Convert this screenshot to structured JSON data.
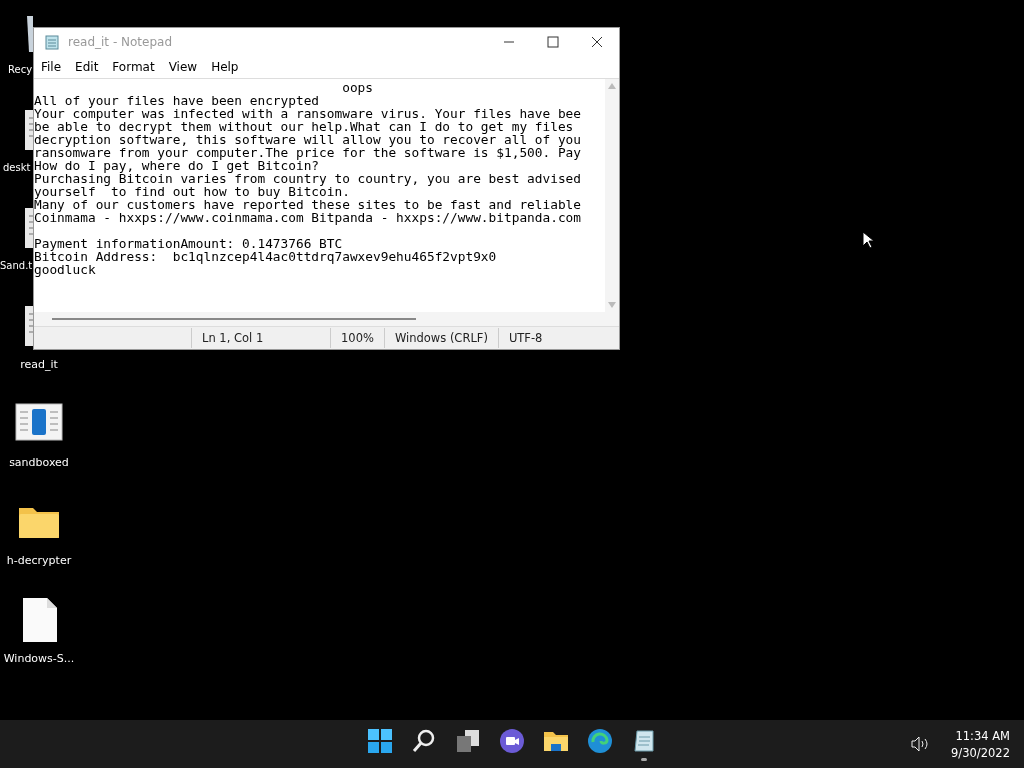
{
  "desktop_icons": [
    {
      "label": "Recy",
      "kind": "recycle"
    },
    {
      "label": "deskt",
      "kind": "doc"
    },
    {
      "label": "Sand.t",
      "kind": "doc"
    },
    {
      "label": "read_it",
      "kind": "text"
    },
    {
      "label": "sandboxed",
      "kind": "app"
    },
    {
      "label": "h-decrypter",
      "kind": "folder"
    },
    {
      "label": "Windows-S...",
      "kind": "file"
    }
  ],
  "window": {
    "title": "read_it - Notepad",
    "menu": [
      "File",
      "Edit",
      "Format",
      "View",
      "Help"
    ],
    "text": "                                        oops\nAll of your files have been encrypted\nYour computer was infected with a ransomware virus. Your files have bee\nbe able to decrypt them without our help.What can I do to get my files\ndecryption software, this software will allow you to recover all of you\nransomware from your computer.The price for the software is $1,500. Pay\nHow do I pay, where do I get Bitcoin?\nPurchasing Bitcoin varies from country to country, you are best advised\nyourself  to find out how to buy Bitcoin.\nMany of our customers have reported these sites to be fast and reliable\nCoinmama - hxxps://www.coinmama.com Bitpanda - hxxps://www.bitpanda.com\n\nPayment informationAmount: 0.1473766 BTC\nBitcoin Address:  bc1qlnzcep4l4ac0ttdrq7awxev9ehu465f2vpt9x0\ngoodluck",
    "status_bar": [
      "Ln 1, Col 1",
      "100%",
      "Windows (CRLF)",
      "UTF-8"
    ]
  },
  "taskbar": {
    "apps": [
      {
        "kind": "start",
        "running": false
      },
      {
        "kind": "search",
        "running": false
      },
      {
        "kind": "taskview",
        "running": false
      },
      {
        "kind": "chat",
        "running": false
      },
      {
        "kind": "explorer",
        "running": false
      },
      {
        "kind": "browser",
        "running": false
      },
      {
        "kind": "notepad",
        "running": true
      }
    ],
    "time": "11:34 AM",
    "date": "9/30/2022"
  }
}
